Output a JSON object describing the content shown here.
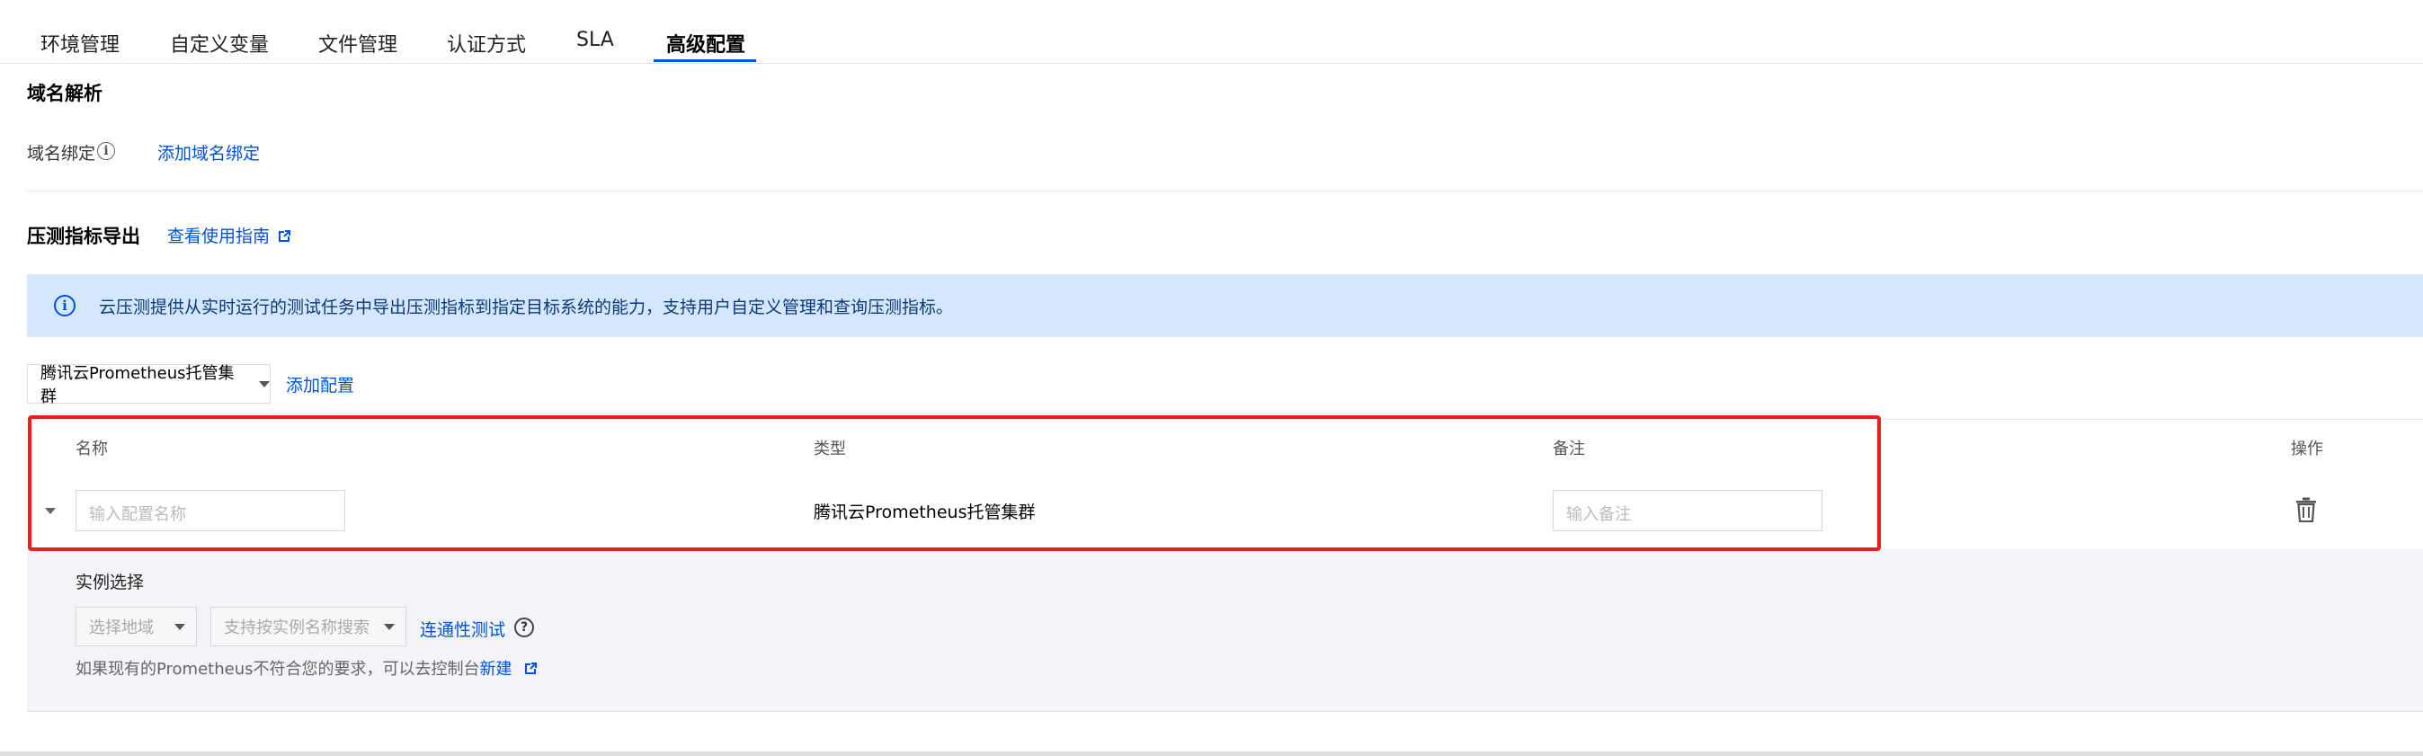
{
  "tabs": [
    {
      "label": "环境管理",
      "active": false
    },
    {
      "label": "自定义变量",
      "active": false
    },
    {
      "label": "文件管理",
      "active": false
    },
    {
      "label": "认证方式",
      "active": false
    },
    {
      "label": "SLA",
      "active": false
    },
    {
      "label": "高级配置",
      "active": true
    }
  ],
  "domain_section": {
    "title": "域名解析",
    "binding_label": "域名绑定",
    "add_link": "添加域名绑定"
  },
  "metrics_section": {
    "title": "压测指标导出",
    "guide_link": "查看使用指南",
    "alert_text": "云压测提供从实时运行的测试任务中导出压测指标到指定目标系统的能力，支持用户自定义管理和查询压测指标。",
    "config_select_value": "腾讯云Prometheus托管集群",
    "add_config_link": "添加配置"
  },
  "table": {
    "headers": {
      "name": "名称",
      "type": "类型",
      "note": "备注",
      "action": "操作"
    },
    "rows": [
      {
        "name_placeholder": "输入配置名称",
        "type": "腾讯云Prometheus托管集群",
        "note_placeholder": "输入备注"
      }
    ]
  },
  "expanded": {
    "title": "实例选择",
    "region_placeholder": "选择地域",
    "instance_placeholder": "支持按实例名称搜索",
    "connectivity_link": "连通性测试",
    "hint_prefix": "如果现有的Prometheus不符合您的要求，可以去控制台",
    "hint_link": "新建"
  },
  "colors": {
    "accent": "#0052d9",
    "alert_bg": "#d5e7ff",
    "highlight_border": "#ee1d1d",
    "expanded_bg": "#f3f4f7"
  },
  "icons": {
    "info": "info-circle-icon",
    "external": "external-link-icon",
    "caret": "caret-down-icon",
    "delete": "trash-icon",
    "help": "question-circle-icon"
  }
}
